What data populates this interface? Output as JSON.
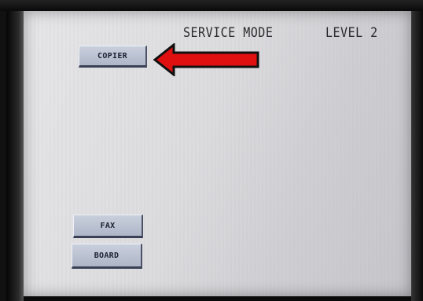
{
  "screen": {
    "title": "SERVICE MODE",
    "level": "LEVEL 2"
  },
  "buttons": {
    "copier": "COPIER",
    "fax": "FAX",
    "board": "BOARD"
  },
  "annotation": {
    "arrow_color": "#e01010",
    "arrow_icon": "left-arrow-icon"
  }
}
